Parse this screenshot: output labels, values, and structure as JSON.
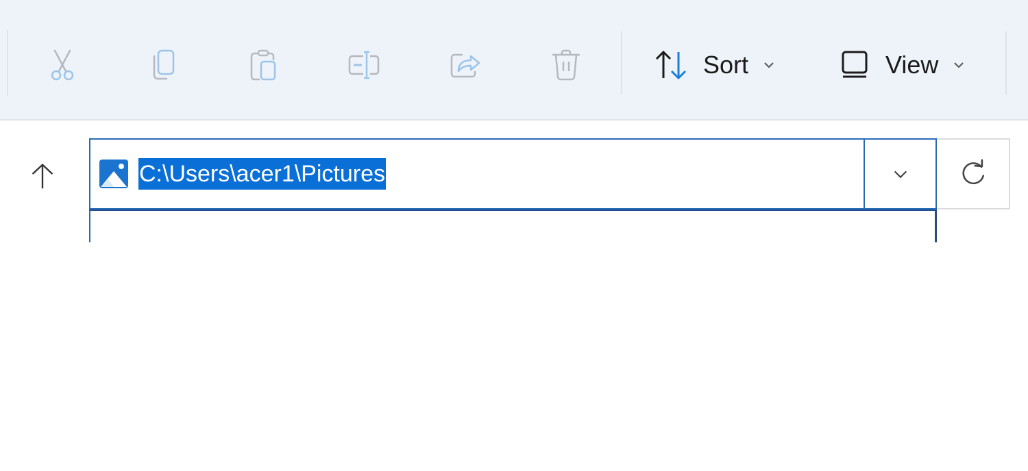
{
  "toolbar": {
    "buttons": [
      {
        "name": "cut",
        "icon": "scissors-icon",
        "enabled": false
      },
      {
        "name": "copy",
        "icon": "copy-icon",
        "enabled": false
      },
      {
        "name": "paste",
        "icon": "clipboard-icon",
        "enabled": false
      },
      {
        "name": "rename",
        "icon": "rename-icon",
        "enabled": false
      },
      {
        "name": "share",
        "icon": "share-icon",
        "enabled": false
      },
      {
        "name": "delete",
        "icon": "trash-icon",
        "enabled": false
      }
    ],
    "sort_label": "Sort",
    "view_label": "View"
  },
  "address_bar": {
    "location_icon": "pictures-folder-icon",
    "path": "C:\\Users\\acer1\\Pictures",
    "selected": true
  },
  "colors": {
    "toolbar_bg": "#eef3f9",
    "accent": "#0a6fd6",
    "focus_border": "#2a6bb8"
  }
}
